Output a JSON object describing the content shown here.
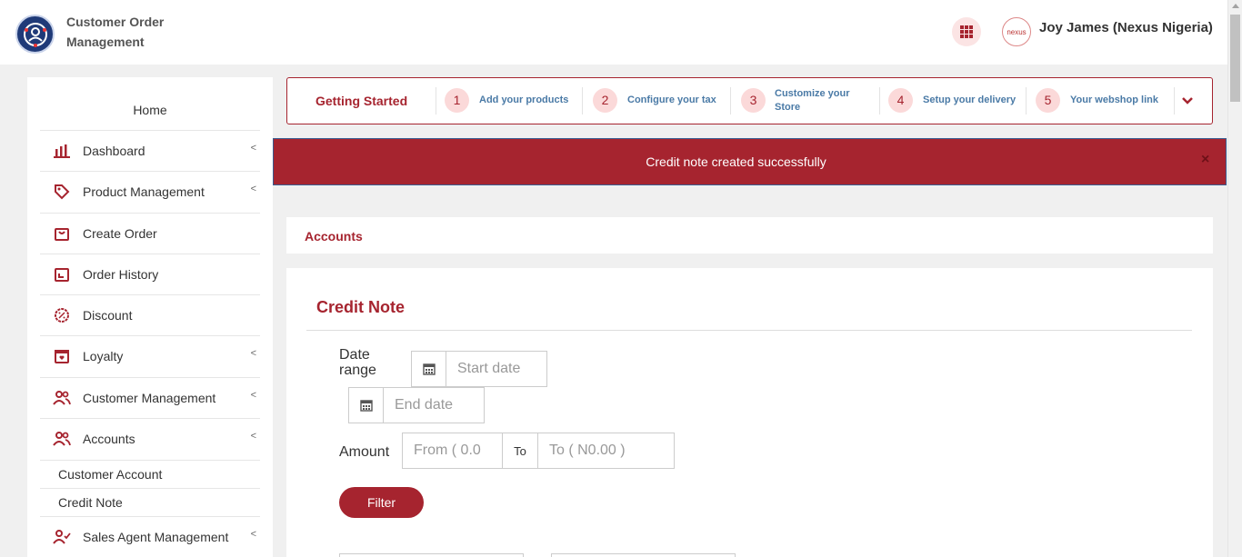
{
  "header": {
    "app_title": "Customer Order Management",
    "user_name": "Joy James (Nexus Nigeria)",
    "avatar_text": "nexus",
    "brand_color": "#a6242f"
  },
  "sidebar": {
    "home": "Home",
    "items": [
      {
        "label": "Dashboard",
        "icon": "bar-chart-icon",
        "expandable": true
      },
      {
        "label": "Product Management",
        "icon": "tag-icon",
        "expandable": true
      },
      {
        "label": "Create Order",
        "icon": "shopping-bag-icon",
        "expandable": false
      },
      {
        "label": "Order History",
        "icon": "history-icon",
        "expandable": false
      },
      {
        "label": "Discount",
        "icon": "discount-badge-icon",
        "expandable": false
      },
      {
        "label": "Loyalty",
        "icon": "loyalty-box-icon",
        "expandable": true
      },
      {
        "label": "Customer Management",
        "icon": "users-icon",
        "expandable": true
      },
      {
        "label": "Accounts",
        "icon": "users-icon",
        "expandable": true
      },
      {
        "label": "Sales Agent Management",
        "icon": "user-check-icon",
        "expandable": true
      }
    ],
    "sub_items": [
      "Customer Account",
      "Credit Note"
    ]
  },
  "getting_started": {
    "title": "Getting Started",
    "steps": [
      {
        "num": "1",
        "label": "Add your products"
      },
      {
        "num": "2",
        "label": "Configure your tax"
      },
      {
        "num": "3",
        "label": "Customize your Store"
      },
      {
        "num": "4",
        "label": "Setup your delivery"
      },
      {
        "num": "5",
        "label": "Your webshop link"
      }
    ]
  },
  "alert": {
    "message": "Credit note created successfully",
    "close": "×"
  },
  "accounts": {
    "title": "Accounts"
  },
  "credit_note": {
    "title": "Credit Note",
    "date_range_label": "Date range",
    "start_placeholder": "Start date",
    "end_placeholder": "End date",
    "amount_label": "Amount",
    "from_placeholder": "From ( 0.0",
    "to_label": "To",
    "to_placeholder": "To ( N0.00 )",
    "filter_label": "Filter"
  }
}
